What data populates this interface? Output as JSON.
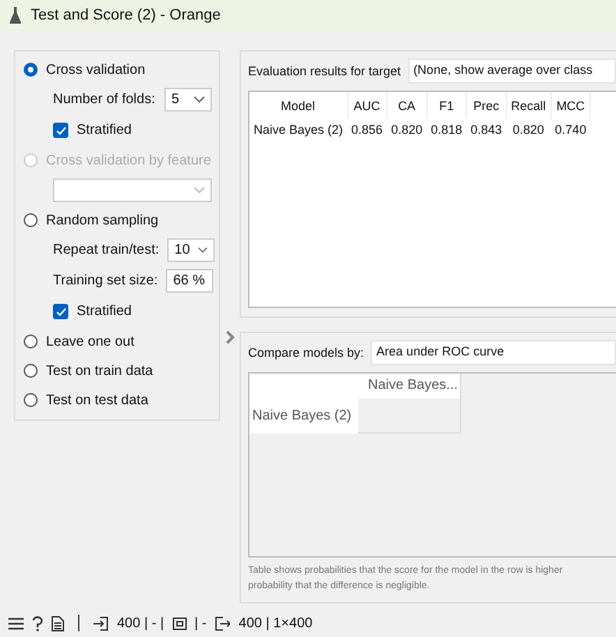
{
  "window": {
    "title": "Test and Score (2) - Orange"
  },
  "sampling": [
    {
      "label": "Cross validation",
      "selected": true,
      "disabled": false,
      "settings": [
        {
          "kind": "combo",
          "label": "Number of folds:",
          "value": "5"
        },
        {
          "kind": "check",
          "label": "Stratified",
          "checked": true
        }
      ]
    },
    {
      "label": "Cross validation by feature",
      "selected": false,
      "disabled": true,
      "settings": [
        {
          "kind": "combo"
        }
      ]
    },
    {
      "label": "Random sampling",
      "selected": false,
      "disabled": false,
      "settings": [
        {
          "kind": "combo",
          "label": "Repeat train/test:",
          "value": "10"
        },
        {
          "kind": "combo",
          "label": "Training set size:",
          "value": "66 %"
        },
        {
          "kind": "check",
          "label": "Stratified",
          "checked": true
        }
      ]
    },
    {
      "label": "Leave one out",
      "selected": false,
      "disabled": false
    },
    {
      "label": "Test on train data",
      "selected": false,
      "disabled": false
    },
    {
      "label": "Test on test data",
      "selected": false,
      "disabled": false
    }
  ],
  "evaluation": {
    "target_label": "Evaluation results for target",
    "target_value": "(None, show average over class",
    "columns": [
      "Model",
      "AUC",
      "CA",
      "F1",
      "Prec",
      "Recall",
      "MCC"
    ],
    "rows": [
      [
        "Naive Bayes (2)",
        "0.856",
        "0.820",
        "0.818",
        "0.843",
        "0.820",
        "0.740"
      ]
    ]
  },
  "comparison": {
    "label": "Compare models by:",
    "value": "Area under ROC curve",
    "column": "Naive Bayes...",
    "row": "Naive Bayes (2)",
    "note": "Table shows probabilities that the score for the model in the row is higher\nprobability that the difference is negligible."
  },
  "status_bar": {
    "input": "400 | - |",
    "middle": "| -",
    "output": "400 | 1×400"
  }
}
